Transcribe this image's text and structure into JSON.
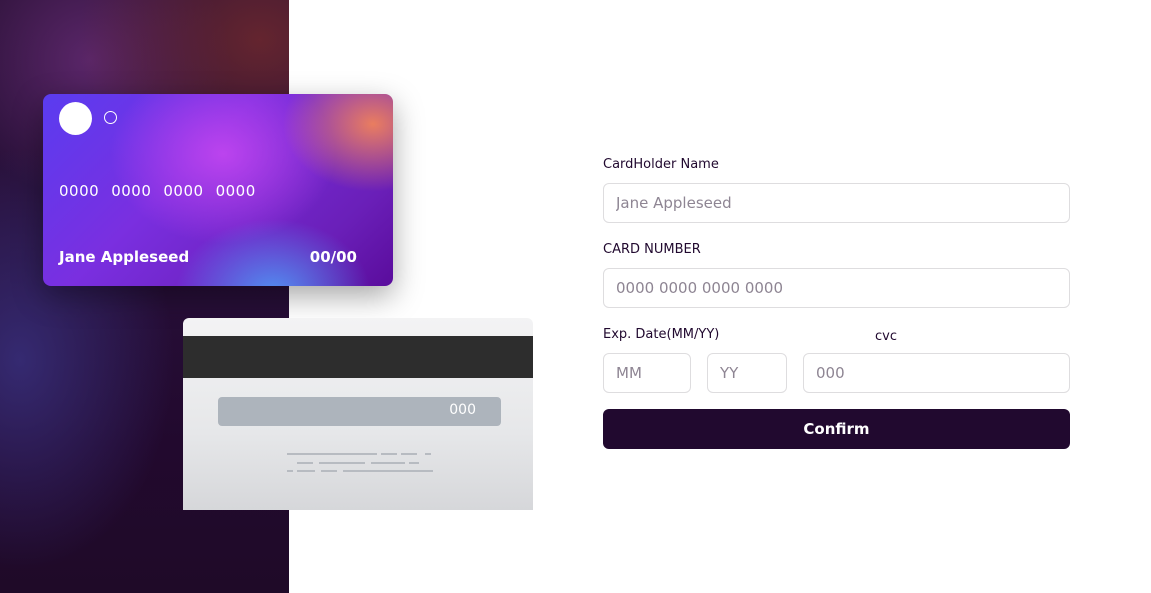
{
  "card_front": {
    "number_groups": [
      "0000",
      "0000",
      "0000",
      "0000"
    ],
    "holder_name": "Jane Appleseed",
    "expiry": "00/00"
  },
  "card_back": {
    "cvc": "000"
  },
  "form": {
    "cardholder_label": "CardHolder Name",
    "cardholder_placeholder": "Jane Appleseed",
    "card_number_label": "CARD NUMBER",
    "card_number_placeholder": "0000 0000 0000 0000",
    "exp_label": "Exp. Date(MM/YY)",
    "month_placeholder": "MM",
    "year_placeholder": "YY",
    "cvc_label": "cvc",
    "cvc_placeholder": "000",
    "confirm_label": "Confirm"
  },
  "colors": {
    "dark_violet": "#21092f",
    "input_border": "#dedddf",
    "placeholder": "#8e8593",
    "card_gradient_start": "#5a3cf0",
    "card_gradient_end": "#5a0c9c"
  }
}
